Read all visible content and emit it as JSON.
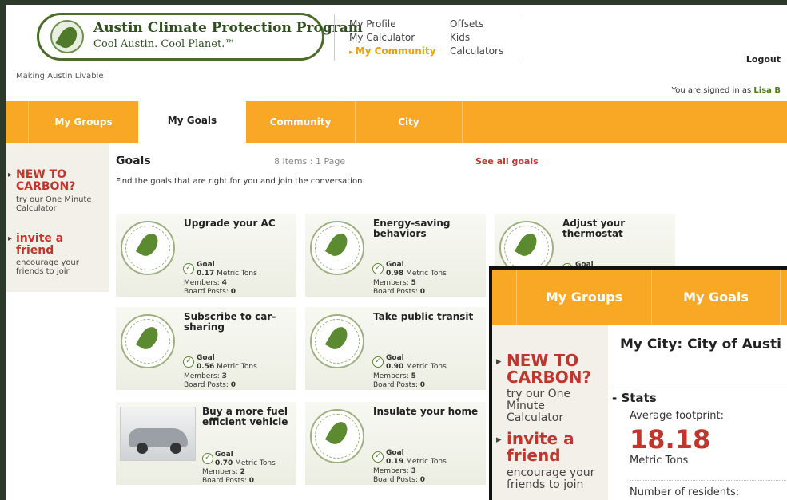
{
  "header": {
    "logo_title": "Austin Climate Protection Program",
    "logo_subtitle": "Cool Austin. Cool Planet.™",
    "tagline": "Making Austin Livable",
    "nav_col1": [
      "My Profile",
      "My Calculator",
      "My Community"
    ],
    "nav_col2": [
      "Offsets",
      "Kids",
      "Calculators"
    ],
    "active_nav": "My Community",
    "logout": "Logout",
    "signed_in_prefix": "You are signed in as",
    "user_name": "Lisa B"
  },
  "tabs": [
    {
      "label": "My Groups",
      "active": false
    },
    {
      "label": "My Goals",
      "active": true
    },
    {
      "label": "Community",
      "active": false
    },
    {
      "label": "City",
      "active": false
    }
  ],
  "sidebar": {
    "promo1_title": "NEW TO CARBON?",
    "promo1_text": "try our One Minute Calculator",
    "promo2_title": "invite a friend",
    "promo2_text": "encourage your friends to join"
  },
  "goals": {
    "title": "Goals",
    "items_count": "8 Items : 1 Page",
    "see_all": "See all goals",
    "intro": "Find the goals that are right for you and join the conversation.",
    "goal_label": "Goal",
    "unit": "Metric Tons",
    "members_label": "Members:",
    "posts_label": "Board Posts:",
    "cards": [
      {
        "title": "Upgrade your AC",
        "value": "0.17",
        "members": "4",
        "posts": "0",
        "image": "seal"
      },
      {
        "title": "Energy-saving behaviors",
        "value": "0.98",
        "members": "5",
        "posts": "0",
        "image": "seal"
      },
      {
        "title": "Adjust your thermostat",
        "value": "",
        "members": "",
        "posts": "",
        "image": "seal"
      },
      {
        "title": "Subscribe to car-sharing",
        "value": "0.56",
        "members": "3",
        "posts": "0",
        "image": "seal"
      },
      {
        "title": "Take public transit",
        "value": "0.90",
        "members": "5",
        "posts": "0",
        "image": "seal"
      },
      {
        "title": "Buy a more fuel efficient vehicle",
        "value": "0.70",
        "members": "2",
        "posts": "0",
        "image": "car"
      },
      {
        "title": "Insulate your home",
        "value": "0.19",
        "members": "3",
        "posts": "0",
        "image": "seal"
      }
    ]
  },
  "overlay": {
    "tabs": [
      "My Groups",
      "My Goals"
    ],
    "city_title": "My City: City of Austi",
    "stats_title": "- Stats",
    "avg_label": "Average footprint:",
    "avg_value": "18.18",
    "avg_unit": "Metric Tons",
    "residents_label": "Number of residents:",
    "promo1_title": "NEW TO CARBON?",
    "promo1_text": "try our One Minute Calculator",
    "promo2_title": "invite a friend",
    "promo2_text": "encourage your friends to join"
  },
  "colors": {
    "tab_orange": "#f9a825",
    "accent_red": "#c0362c",
    "brand_green": "#4a6b2a"
  }
}
